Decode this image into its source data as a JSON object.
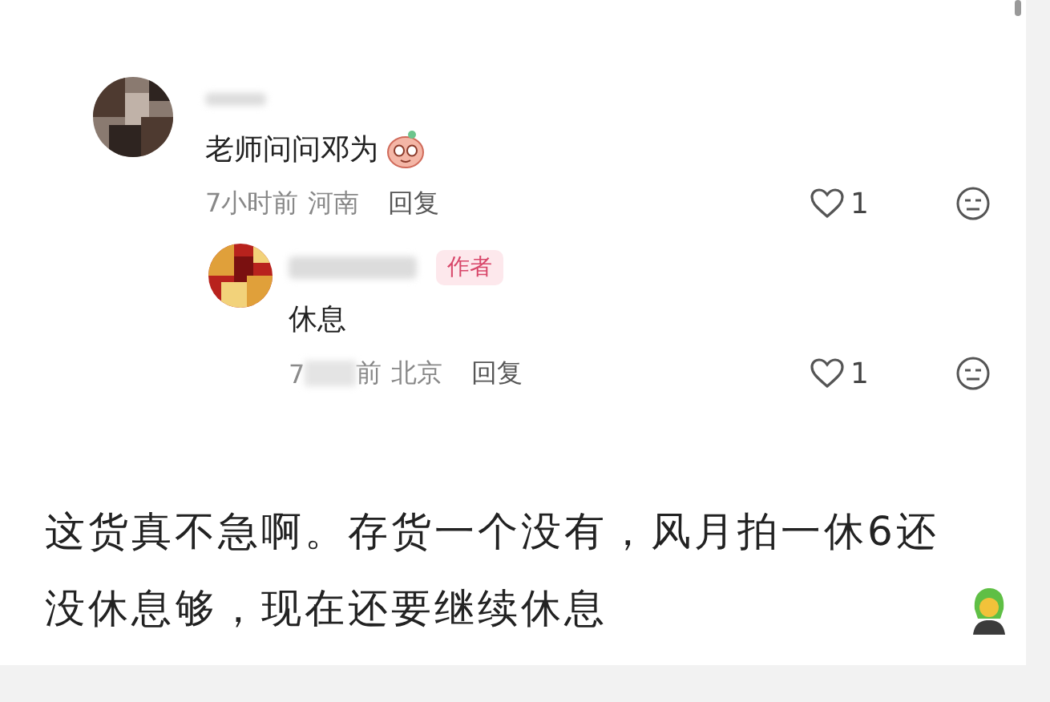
{
  "comments": [
    {
      "text": "老师问问邓为",
      "sticker": true,
      "time": "7小时前",
      "location": "河南",
      "reply_label": "回复",
      "likes": "1",
      "replies": [
        {
          "author_tag": "作者",
          "text": "休息",
          "time": "7",
          "time_tail": "前",
          "location": "北京",
          "reply_label": "回复",
          "likes": "1"
        }
      ]
    }
  ],
  "post_text": "这货真不急啊。存货一个没有，风月拍一休6还没休息够，现在还要继续休息"
}
